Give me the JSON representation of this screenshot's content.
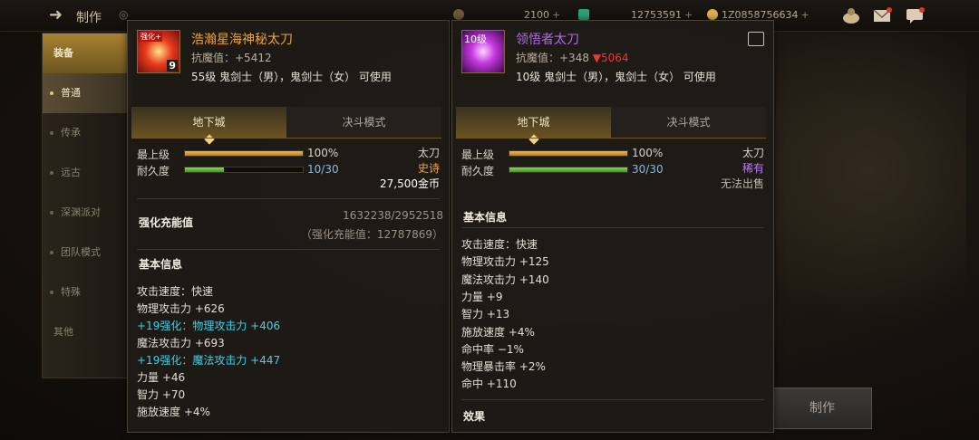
{
  "topbar": {
    "title": "制作",
    "resources": [
      {
        "value": "2100",
        "color": "#d9a43a"
      },
      {
        "value": "12753591",
        "color": "#37c48a"
      },
      {
        "value": "1Z0858756634",
        "color": "#e4b64a"
      }
    ]
  },
  "sidebar": {
    "items": [
      {
        "label": "装备"
      },
      {
        "label": "普通"
      },
      {
        "label": "传承"
      },
      {
        "label": "远古"
      },
      {
        "label": "深渊派对"
      },
      {
        "label": "团队模式"
      },
      {
        "label": "特殊"
      },
      {
        "label": "其他"
      }
    ]
  },
  "make_button": "制作",
  "left_item": {
    "icon_badge": "9",
    "icon_ribbon": "强化+",
    "name": "浩瀚星海神秘太刀",
    "name_color": "#f0a33a",
    "resist": "抗魔值：+5412",
    "usable": "55级 鬼剑士（男），鬼剑士（女） 可使用",
    "tabs": [
      "地下城",
      "决斗模式"
    ],
    "level_label": "最上级",
    "level_value": "100%",
    "level_fraction": 1.0,
    "durability_label": "耐久度",
    "durability_value": "10/30",
    "durability_fraction": 0.33,
    "type": "太刀",
    "rarity": "史诗",
    "rarity_color": "#f0a33a",
    "price": "27,500金币",
    "amp_label": "强化充能值",
    "amp_value": "1632238/2952518",
    "amp_sub": "（强化充能值：12787869）",
    "basic_title": "基本信息",
    "stats": [
      {
        "text": "攻击速度：快速",
        "cyan": false
      },
      {
        "text": "物理攻击力 +626",
        "cyan": false
      },
      {
        "text": "+19强化：物理攻击力 +406",
        "cyan": true
      },
      {
        "text": "魔法攻击力 +693",
        "cyan": false
      },
      {
        "text": "+19强化：魔法攻击力 +447",
        "cyan": true
      },
      {
        "text": "力量 +46",
        "cyan": false
      },
      {
        "text": "智力 +70",
        "cyan": false
      },
      {
        "text": "施放速度 +4%",
        "cyan": false
      }
    ]
  },
  "right_item": {
    "icon_level": "10级",
    "name": "领悟者太刀",
    "name_color": "#b26bea",
    "resist": "抗魔值：+348",
    "resist_drop": "▼5064",
    "usable": "10级 鬼剑士（男），鬼剑士（女） 可使用",
    "tabs": [
      "地下城",
      "决斗模式"
    ],
    "level_label": "最上级",
    "level_value": "100%",
    "level_fraction": 1.0,
    "durability_label": "耐久度",
    "durability_value": "30/30",
    "durability_fraction": 1.0,
    "type": "太刀",
    "rarity": "稀有",
    "rarity_color": "#b77df0",
    "trade": "无法出售",
    "basic_title": "基本信息",
    "stats": [
      "攻击速度：快速",
      "物理攻击力 +125",
      "魔法攻击力 +140",
      "力量 +9",
      "智力 +13",
      "施放速度 +4%",
      "命中率 −1%",
      "物理暴击率 +2%",
      "命中 +110"
    ],
    "effect_title": "效果"
  }
}
